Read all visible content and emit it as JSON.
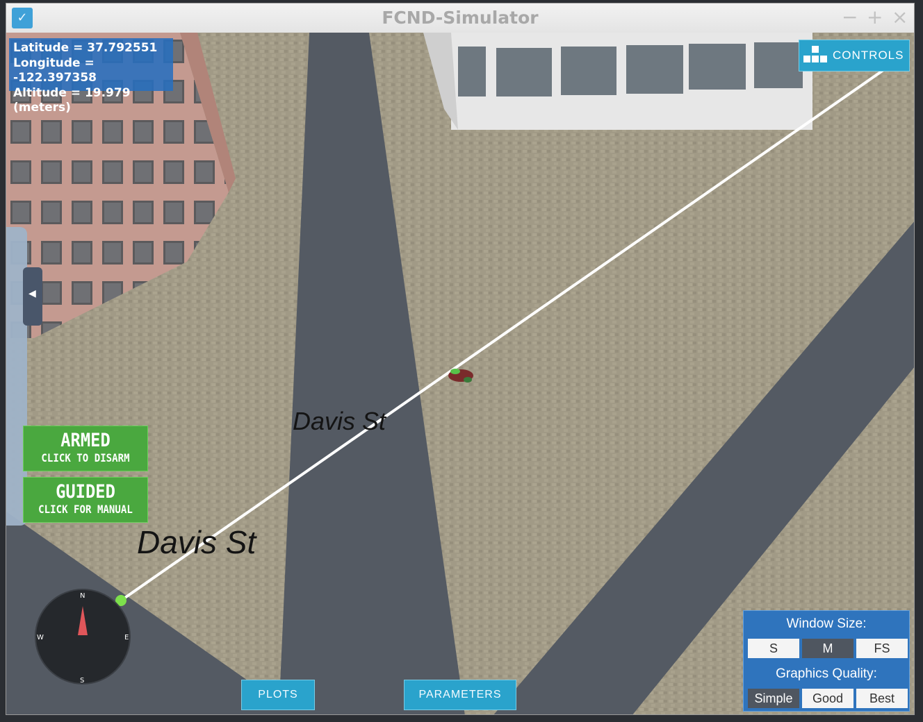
{
  "window": {
    "title": "FCND-Simulator",
    "app_icon": "unity-icon"
  },
  "telemetry": {
    "latitude": "Latitude = 37.792551",
    "longitude": "Longitude = -122.397358",
    "altitude": "Altitude = 19.979 (meters)"
  },
  "controls_label": "CONTROLS",
  "armed": {
    "title": "ARMED",
    "subtitle": "CLICK TO DISARM"
  },
  "guided": {
    "title": "GUIDED",
    "subtitle": "CLICK FOR MANUAL"
  },
  "street_labels": [
    "Davis St",
    "Davis St"
  ],
  "compass": {
    "n": "N",
    "s": "S",
    "e": "E",
    "w": "W"
  },
  "bottom": {
    "plots": "PLOTS",
    "parameters": "PARAMETERS"
  },
  "settings": {
    "window_size_label": "Window Size:",
    "window_sizes": [
      "S",
      "M",
      "FS"
    ],
    "selected_window_size": "M",
    "graphics_label": "Graphics Quality:",
    "qualities": [
      "Simple",
      "Good",
      "Best"
    ],
    "selected_quality": "Simple"
  },
  "colors": {
    "accent": "#2aa3cc",
    "armed_green": "#4aa83f",
    "panel_blue": "#2f74bd"
  }
}
